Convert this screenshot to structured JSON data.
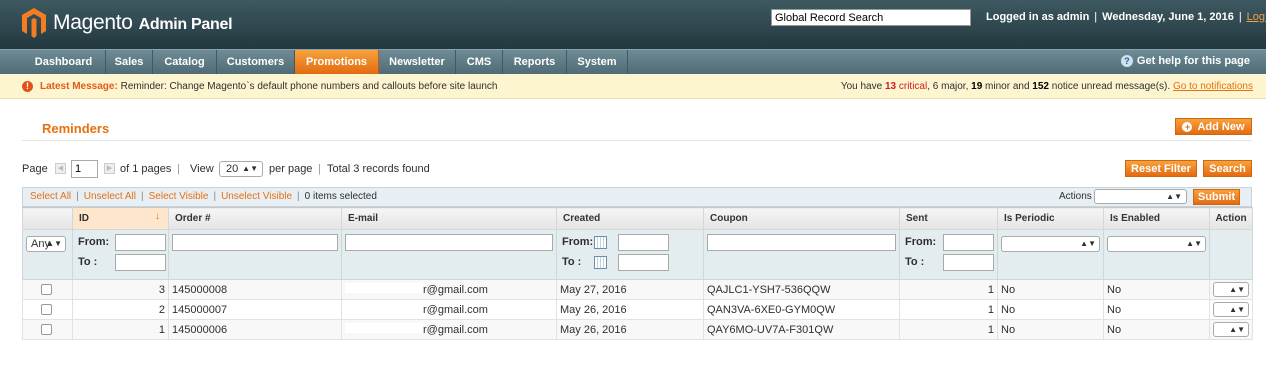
{
  "header": {
    "brand": "Magento",
    "brand_sub": "Admin Panel",
    "search_value": "Global Record Search",
    "logged_in": "Logged in as admin",
    "date": "Wednesday, June 1, 2016",
    "logout": "Log Out"
  },
  "nav": {
    "items": [
      "Dashboard",
      "Sales",
      "Catalog",
      "Customers",
      "Promotions",
      "Newsletter",
      "CMS",
      "Reports",
      "System"
    ],
    "active": "Promotions",
    "help": "Get help for this page"
  },
  "notice": {
    "label": "Latest Message:",
    "message": "Reminder: Change Magento`s default phone numbers and callouts before site launch",
    "pre": "You have",
    "critical_count": "13",
    "critical": "critical",
    "major": "6 major,",
    "minor_count": "19",
    "minor": "minor and",
    "notice_count": "152",
    "notice_tail": "notice unread message(s).",
    "link": "Go to notifications"
  },
  "page": {
    "title": "Reminders",
    "add_new": "Add New",
    "reset_filter": "Reset Filter",
    "search": "Search"
  },
  "pager": {
    "page_label": "Page",
    "page_value": "1",
    "of_pages": "of 1 pages",
    "view_label": "View",
    "per_page_value": "20",
    "per_page": "per page",
    "total": "Total 3 records found"
  },
  "massaction": {
    "select_all": "Select All",
    "unselect_all": "Unselect All",
    "select_visible": "Select Visible",
    "unselect_visible": "Unselect Visible",
    "selected": "0 items selected",
    "actions_label": "Actions",
    "submit": "Submit"
  },
  "grid": {
    "columns": [
      "ID",
      "Order #",
      "E-mail",
      "Created",
      "Coupon",
      "Sent",
      "Is Periodic",
      "Is Enabled",
      "Action"
    ],
    "filter": {
      "any": "Any",
      "from": "From:",
      "to": "To :"
    },
    "rows": [
      {
        "id": "3",
        "order": "145000008",
        "email": "r@gmail.com",
        "created": "May 27, 2016",
        "coupon": "QAJLC1-YSH7-536QQW",
        "sent": "1",
        "periodic": "No",
        "enabled": "No"
      },
      {
        "id": "2",
        "order": "145000007",
        "email": "r@gmail.com",
        "created": "May 26, 2016",
        "coupon": "QAN3VA-6XE0-GYM0QW",
        "sent": "1",
        "periodic": "No",
        "enabled": "No"
      },
      {
        "id": "1",
        "order": "145000006",
        "email": "r@gmail.com",
        "created": "May 26, 2016",
        "coupon": "QAY6MO-UV7A-F301QW",
        "sent": "1",
        "periodic": "No",
        "enabled": "No"
      }
    ]
  }
}
